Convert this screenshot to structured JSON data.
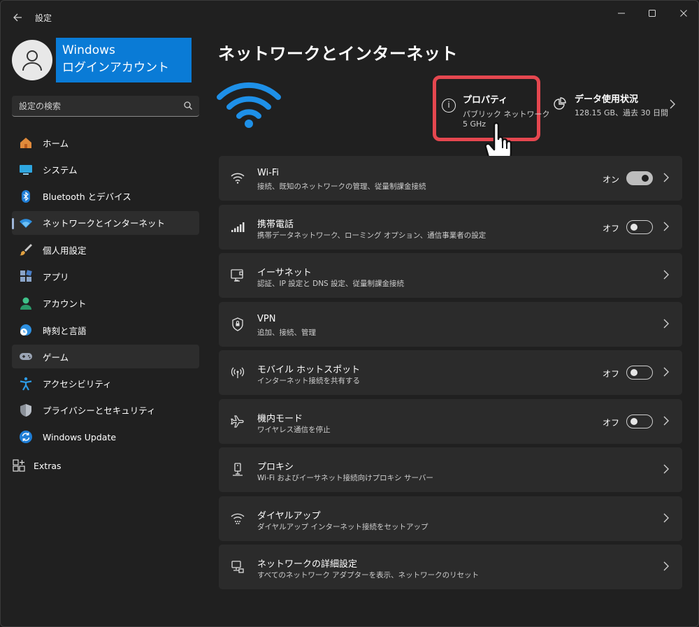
{
  "window": {
    "title": "設定"
  },
  "account": {
    "line1": "Windows",
    "line2": "ログインアカウント"
  },
  "search": {
    "placeholder": "設定の検索"
  },
  "nav": {
    "items": [
      {
        "label": "ホーム",
        "icon": "home-icon"
      },
      {
        "label": "システム",
        "icon": "system-icon"
      },
      {
        "label": "Bluetooth とデバイス",
        "icon": "bluetooth-icon"
      },
      {
        "label": "ネットワークとインターネット",
        "icon": "network-icon",
        "active": true
      },
      {
        "label": "個人用設定",
        "icon": "brush-icon"
      },
      {
        "label": "アプリ",
        "icon": "apps-icon"
      },
      {
        "label": "アカウント",
        "icon": "account-icon"
      },
      {
        "label": "時刻と言語",
        "icon": "globe-clock-icon"
      },
      {
        "label": "ゲーム",
        "icon": "gamepad-icon",
        "hover": true
      },
      {
        "label": "アクセシビリティ",
        "icon": "accessibility-icon"
      },
      {
        "label": "プライバシーとセキュリティ",
        "icon": "shield-icon"
      },
      {
        "label": "Windows Update",
        "icon": "update-icon"
      }
    ],
    "extras": "Extras"
  },
  "main": {
    "title": "ネットワークとインターネット",
    "properties": {
      "title": "プロパティ",
      "line1": "パブリック ネットワーク",
      "line2": "5 GHz"
    },
    "usage": {
      "title": "データ使用状況",
      "sub": "128.15 GB、過去 30 日間"
    },
    "rows": [
      {
        "title": "Wi-Fi",
        "sub": "接続、既知のネットワークの管理、従量制課金接続",
        "icon": "wifi-icon",
        "toggle": "オン",
        "on": true
      },
      {
        "title": "携帯電話",
        "sub": "携帯データネットワーク、ローミング オプション、通信事業者の設定",
        "icon": "cellular-icon",
        "toggle": "オフ",
        "on": false
      },
      {
        "title": "イーサネット",
        "sub": "認証、IP 設定と DNS 設定、従量制課金接続",
        "icon": "ethernet-icon"
      },
      {
        "title": "VPN",
        "sub": "追加、接続、管理",
        "icon": "vpn-shield-icon"
      },
      {
        "title": "モバイル ホットスポット",
        "sub": "インターネット接続を共有する",
        "icon": "hotspot-icon",
        "toggle": "オフ",
        "on": false
      },
      {
        "title": "機内モード",
        "sub": "ワイヤレス通信を停止",
        "icon": "airplane-icon",
        "toggle": "オフ",
        "on": false
      },
      {
        "title": "プロキシ",
        "sub": "Wi-Fi およびイーサネット接続向けプロキシ サーバー",
        "icon": "proxy-icon"
      },
      {
        "title": "ダイヤルアップ",
        "sub": "ダイヤルアップ インターネット接続をセットアップ",
        "icon": "dialup-icon"
      },
      {
        "title": "ネットワークの詳細設定",
        "sub": "すべてのネットワーク アダプターを表示、ネットワークのリセット",
        "icon": "advanced-network-icon"
      }
    ]
  },
  "colors": {
    "accent": "#0a7bd6",
    "highlight": "#e5474f",
    "background": "#202020",
    "card": "#2b2b2b"
  }
}
